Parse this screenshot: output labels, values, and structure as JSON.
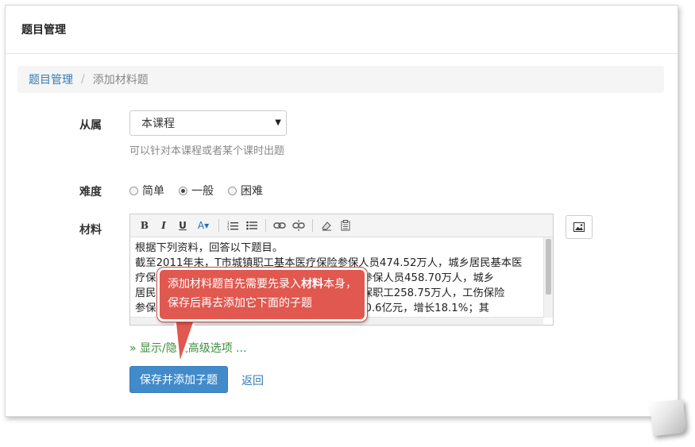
{
  "panel": {
    "title": "题目管理"
  },
  "breadcrumb": {
    "root": "题目管理",
    "separator": "/",
    "current": "添加材料题"
  },
  "form": {
    "belong": {
      "label": "从属",
      "selected": "本课程",
      "help": "可以针对本课程或者某个课时出题"
    },
    "difficulty": {
      "label": "难度",
      "options": [
        "简单",
        "一般",
        "困难"
      ],
      "selected": "一般"
    },
    "material": {
      "label": "材料",
      "lines": [
        "根据下列资料，回答以下题目。",
        "截至2011年末，T市城镇职工基本医疗保险参保人员474.52万人，城乡居民基本医",
        "疗保险参保人员584.68万人，城镇职工养老保险参保人员458.70万人，城乡",
        "居民养老保险参保人员191.23万人，失业保险参保职工258.75万人，工伤保险",
        "参保职工290.70万人。全年社会保险基金收入510.6亿元，增长18.1%；其"
      ]
    },
    "advanced_toggle": "» 显示/隐藏高级选项 ...",
    "submit_label": "保存并添加子题",
    "back_label": "返回"
  },
  "toolbar": {
    "bold": "B",
    "italic": "I",
    "underline": "U",
    "font_color": "A▾",
    "icons": [
      "ordered-list-icon",
      "unordered-list-icon",
      "link-icon",
      "unlink-icon",
      "eraser-icon",
      "paste-icon"
    ]
  },
  "callout": {
    "text_before": "添加材料题首先需要先录入",
    "text_bold": "材料",
    "text_after": "本身，保存后再去添加它下面的子题"
  },
  "colors": {
    "primary": "#428bca",
    "link": "#337ab7",
    "callout": "#e0584f",
    "advanced": "#3c8d3c"
  }
}
